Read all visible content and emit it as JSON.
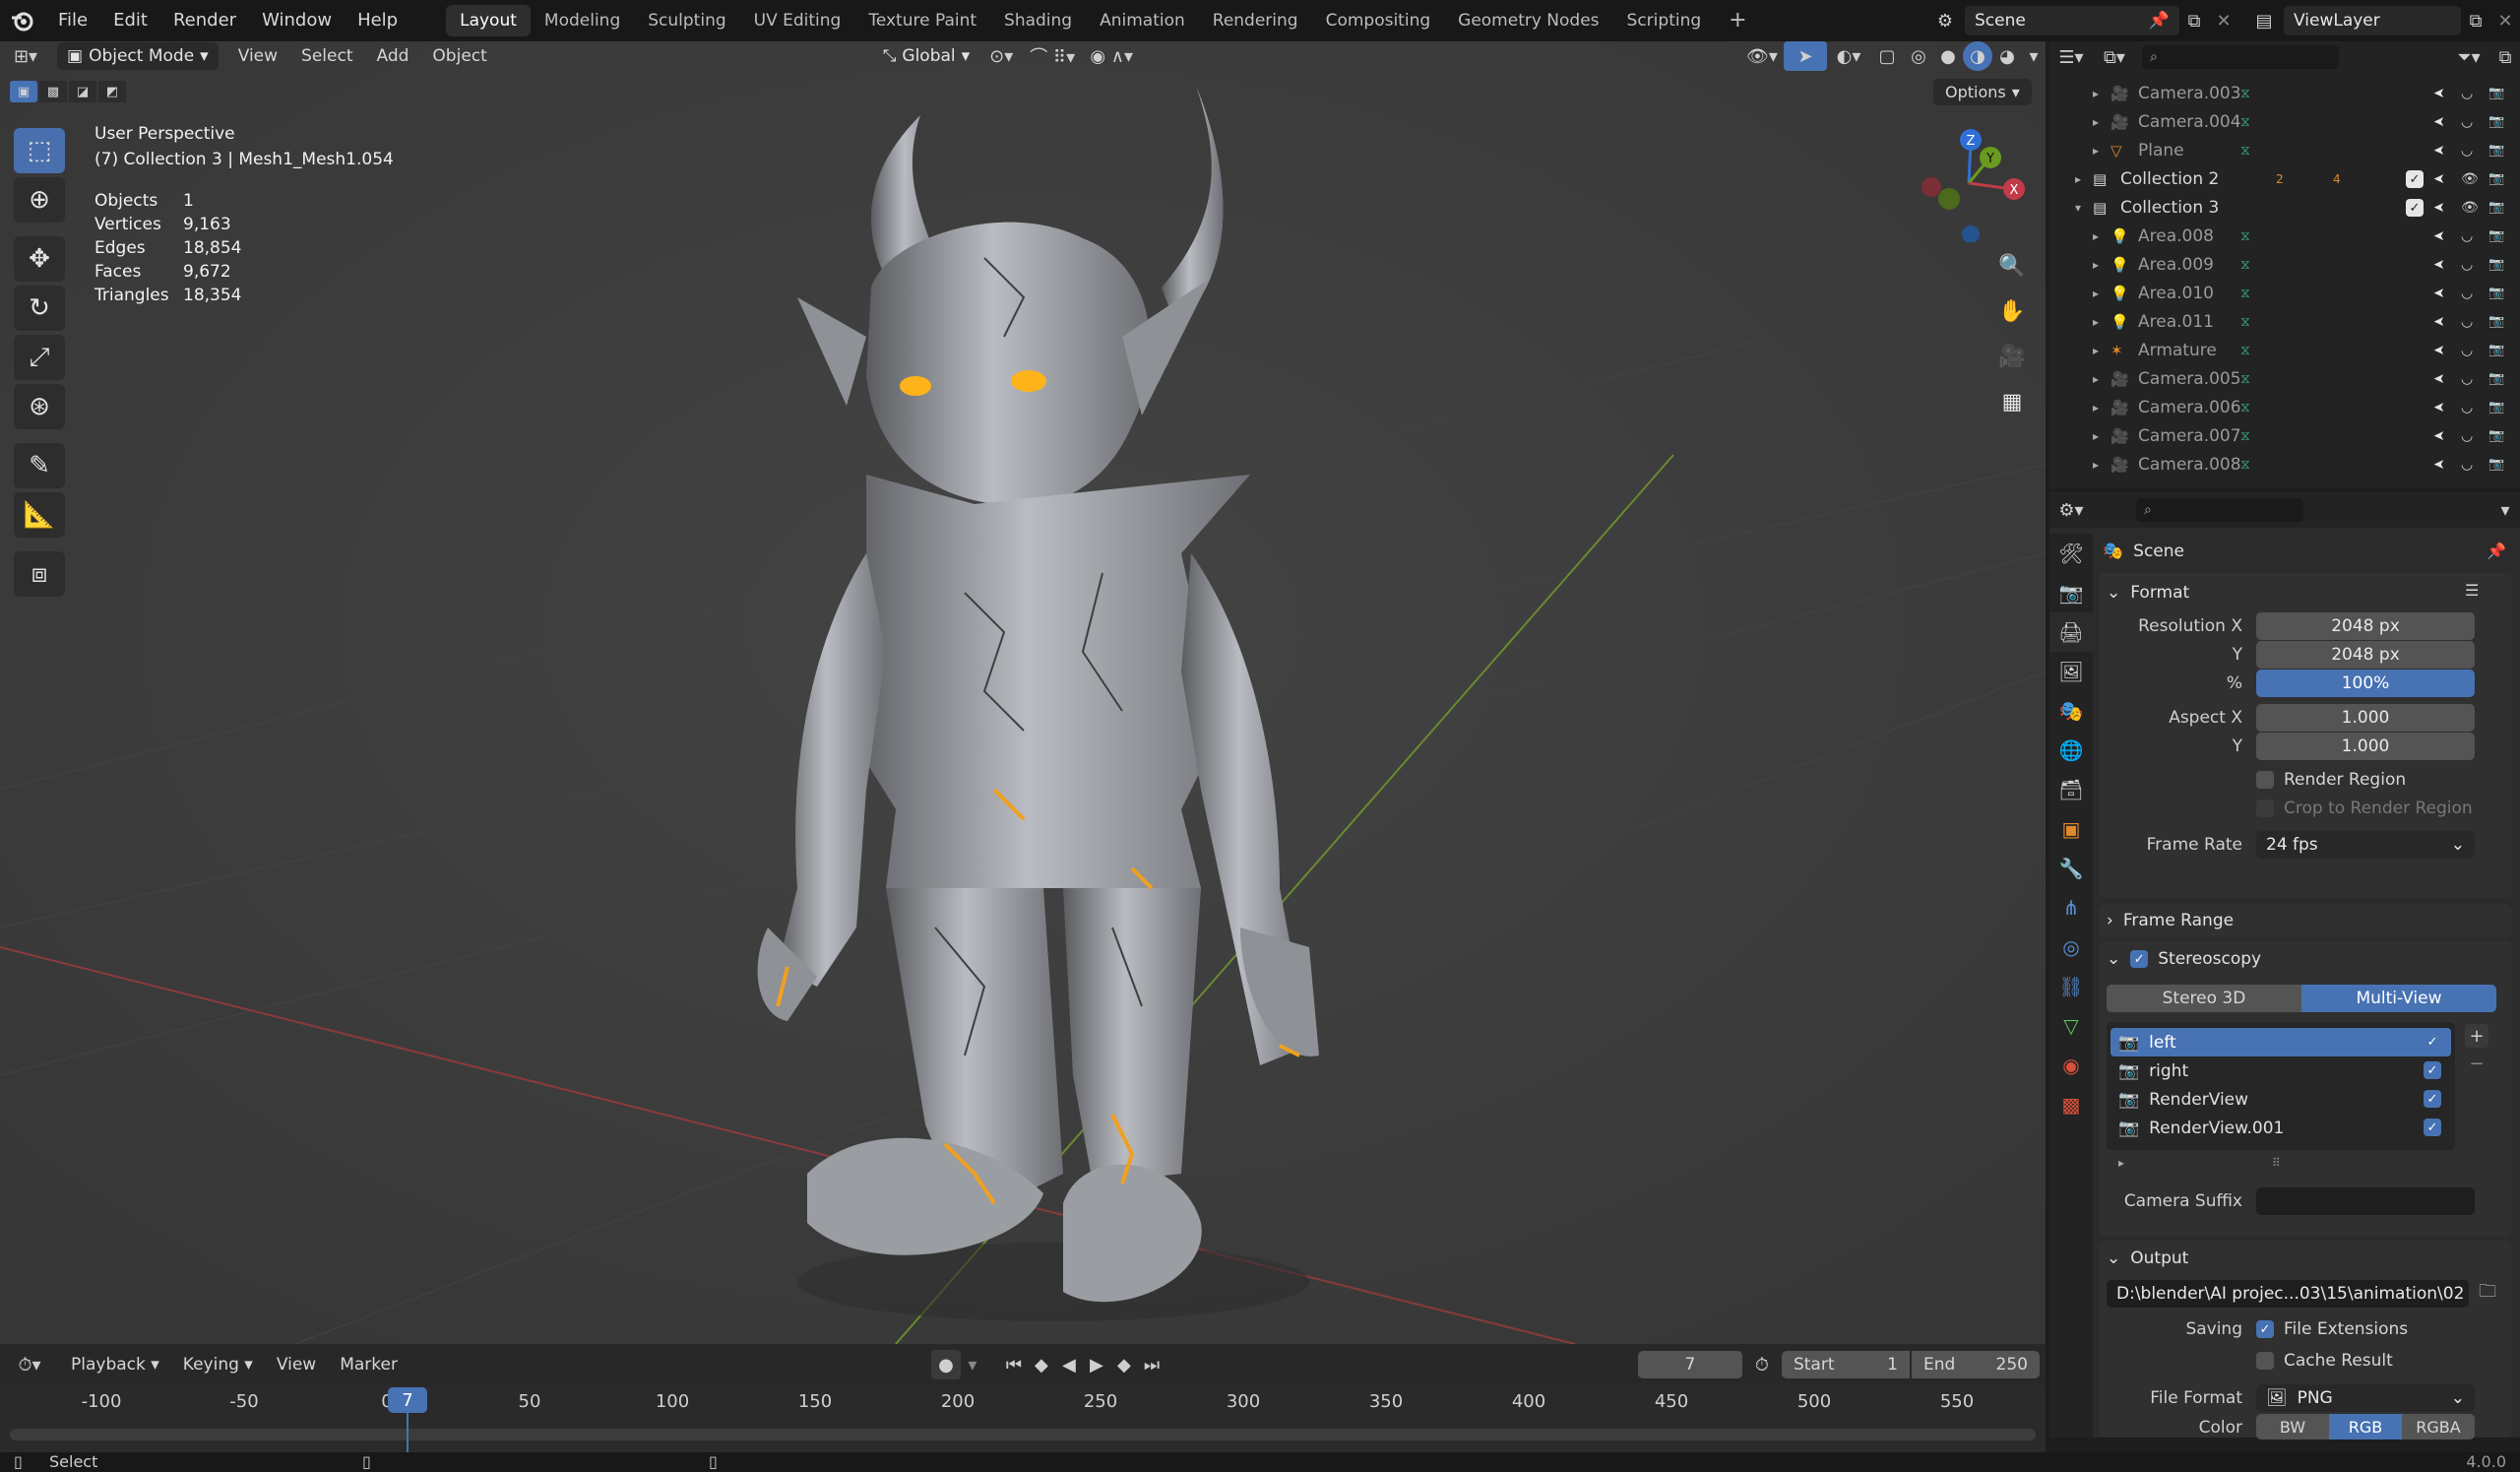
{
  "topbar": {
    "menus": [
      "File",
      "Edit",
      "Render",
      "Window",
      "Help"
    ],
    "workspaces": [
      "Layout",
      "Modeling",
      "Sculpting",
      "UV Editing",
      "Texture Paint",
      "Shading",
      "Animation",
      "Rendering",
      "Compositing",
      "Geometry Nodes",
      "Scripting"
    ],
    "active_workspace": "Layout",
    "add_tab": "+",
    "scene": "Scene",
    "view_layer": "ViewLayer"
  },
  "viewport": {
    "mode": "Object Mode",
    "menus": [
      "View",
      "Select",
      "Add",
      "Object"
    ],
    "orientation": "Global",
    "options": "Options",
    "overlay_title": "User Perspective",
    "overlay_subtitle": "(7) Collection 3 | Mesh1_Mesh1.054",
    "stats": [
      {
        "label": "Objects",
        "value": "1"
      },
      {
        "label": "Vertices",
        "value": "9,163"
      },
      {
        "label": "Edges",
        "value": "18,854"
      },
      {
        "label": "Faces",
        "value": "9,672"
      },
      {
        "label": "Triangles",
        "value": "18,354"
      }
    ],
    "gizmo": {
      "z": "Z",
      "y": "Y",
      "x": "X"
    }
  },
  "outliner": {
    "rows": [
      {
        "name": "Camera.003",
        "icon": "camera-icon",
        "type": "object"
      },
      {
        "name": "Camera.004",
        "icon": "camera-icon",
        "type": "object"
      },
      {
        "name": "Plane",
        "icon": "mesh-icon",
        "type": "object"
      },
      {
        "name": "Collection 2",
        "icon": "collection-icon",
        "type": "collection",
        "badge": "2",
        "badge2": "4"
      },
      {
        "name": "Collection 3",
        "icon": "collection-icon",
        "type": "collection"
      },
      {
        "name": "Area.008",
        "icon": "light-icon",
        "type": "object"
      },
      {
        "name": "Area.009",
        "icon": "light-icon",
        "type": "object"
      },
      {
        "name": "Area.010",
        "icon": "light-icon",
        "type": "object"
      },
      {
        "name": "Area.011",
        "icon": "light-icon",
        "type": "object"
      },
      {
        "name": "Armature",
        "icon": "armature-icon",
        "type": "object"
      },
      {
        "name": "Camera.005",
        "icon": "camera-icon",
        "type": "object"
      },
      {
        "name": "Camera.006",
        "icon": "camera-icon",
        "type": "object"
      },
      {
        "name": "Camera.007",
        "icon": "camera-icon",
        "type": "object"
      },
      {
        "name": "Camera.008",
        "icon": "camera-icon",
        "type": "object"
      }
    ]
  },
  "properties": {
    "context": "Scene",
    "format": {
      "title": "Format",
      "res_x_label": "Resolution X",
      "res_x": "2048 px",
      "res_y_label": "Y",
      "res_y": "2048 px",
      "pct_label": "%",
      "pct": "100%",
      "aspect_x_label": "Aspect X",
      "aspect_x": "1.000",
      "aspect_y_label": "Y",
      "aspect_y": "1.000",
      "render_region": "Render Region",
      "crop": "Crop to Render Region",
      "frame_rate_label": "Frame Rate",
      "frame_rate": "24 fps"
    },
    "frame_range": "Frame Range",
    "stereoscopy": {
      "title": "Stereoscopy",
      "mode_a": "Stereo 3D",
      "mode_b": "Multi-View",
      "views": [
        "left",
        "right",
        "RenderView",
        "RenderView.001"
      ],
      "camera_suffix_label": "Camera Suffix",
      "camera_suffix": ""
    },
    "output": {
      "title": "Output",
      "path": "D:\\blender\\AI projec...03\\15\\animation\\02",
      "saving_label": "Saving",
      "file_extensions": "File Extensions",
      "cache_result": "Cache Result",
      "file_format_label": "File Format",
      "file_format": "PNG",
      "color_label": "Color",
      "color_modes": [
        "BW",
        "RGB",
        "RGBA"
      ],
      "color_active": "RGB"
    }
  },
  "timeline": {
    "menus": [
      "Playback",
      "Keying",
      "View",
      "Marker"
    ],
    "current_frame": "7",
    "start_label": "Start",
    "start": "1",
    "end_label": "End",
    "end": "250",
    "ticks": [
      "-100",
      "-50",
      "0",
      "50",
      "100",
      "150",
      "200",
      "250",
      "300",
      "350",
      "400",
      "450",
      "500",
      "550"
    ],
    "playhead": "7"
  },
  "statusbar": {
    "left": "Select",
    "version": "4.0.0"
  },
  "colors": {
    "accent": "#4772b3",
    "viewport": "#3a3a3a",
    "header": "#181818",
    "panel": "#2b2b2b"
  }
}
